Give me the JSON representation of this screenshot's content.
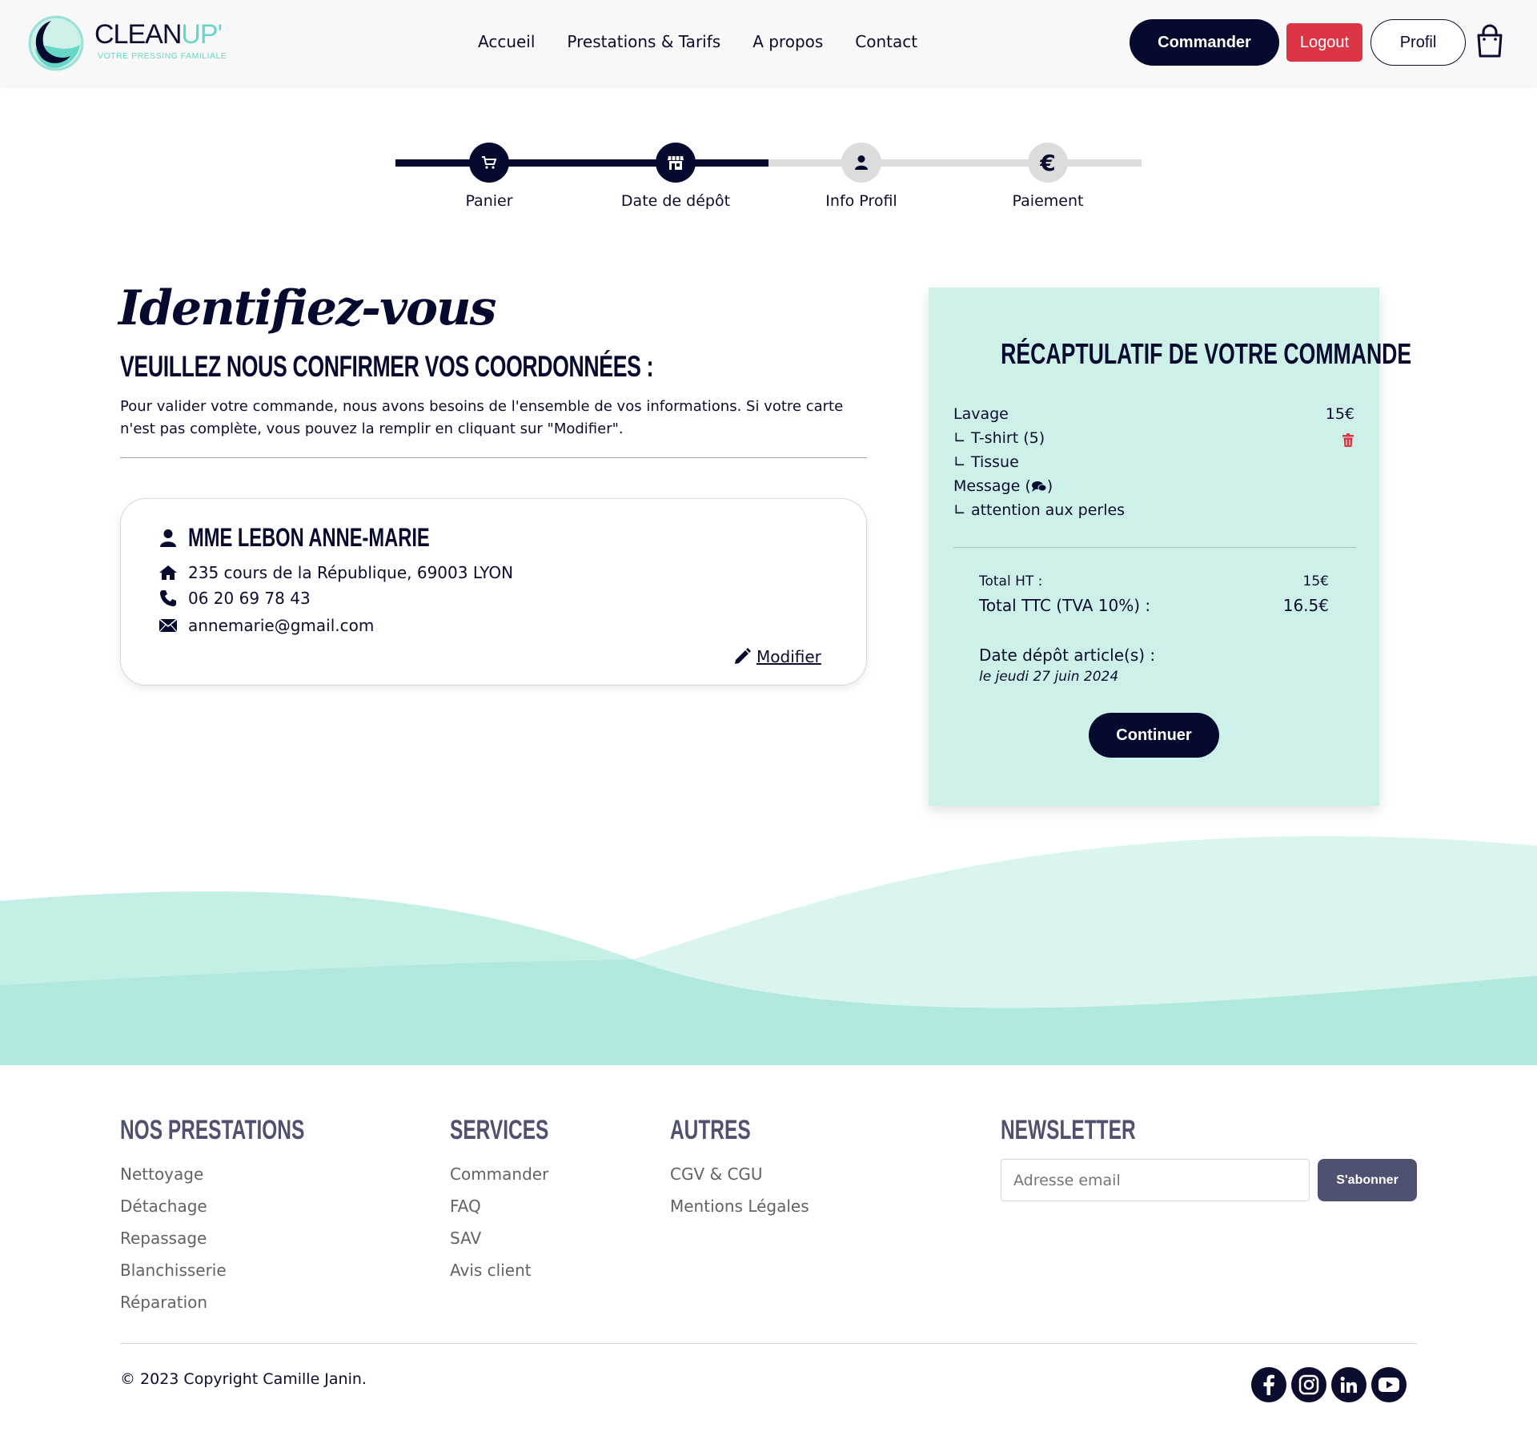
{
  "brand": {
    "name_main": "CLEAN",
    "name_accent": "UP'",
    "tagline": "VOTRE PRESSING FAMILIALE",
    "accent": "#68d6c6",
    "navy": "#050a2e"
  },
  "nav": {
    "items": [
      "Accueil",
      "Prestations & Tarifs",
      "A propos",
      "Contact"
    ]
  },
  "header_actions": {
    "commander": "Commander",
    "logout": "Logout",
    "profil": "Profil",
    "cart_icon": "shopping-bag-icon"
  },
  "stepper": {
    "current_step": 2,
    "steps": [
      {
        "label": "Panier",
        "icon": "cart-icon",
        "done": true
      },
      {
        "label": "Date de dépôt",
        "icon": "store-icon",
        "done": true
      },
      {
        "label": "Info Profil",
        "icon": "user-icon",
        "done": false
      },
      {
        "label": "Paiement",
        "icon": "euro-icon",
        "done": false
      }
    ]
  },
  "main": {
    "script_title": "Identifiez-vous",
    "heading": "VEUILLEZ NOUS CONFIRMER VOS COORDONNÉES :",
    "intro": "Pour valider votre commande, nous avons besoins de l'ensemble de vos informations. Si votre carte n'est pas complète, vous pouvez la remplir en cliquant sur \"Modifier\"."
  },
  "profile_card": {
    "name": "MME LEBON ANNE-MARIE",
    "address": "235 cours de la République, 69003 LYON",
    "phone": "06 20 69 78 43",
    "email": "annemarie@gmail.com",
    "modify": "Modifier"
  },
  "recap": {
    "title": "RÉCAPTULATIF DE VOTRE COMMANDE",
    "service": "Lavage",
    "service_price": "15€",
    "item": "∟ T-shirt (5)",
    "fabric": "∟ Tissue",
    "message_label": "Message (",
    "message_close": ")",
    "message": "∟ attention aux perles",
    "total_ht_label": "Total HT :",
    "total_ht": "15€",
    "total_ttc_label": "Total TTC (TVA 10%) :",
    "total_ttc": "16.5€",
    "date_label": "Date dépôt article(s) :",
    "date_value": "le jeudi 27 juin 2024",
    "continue": "Continuer"
  },
  "footer": {
    "col1": {
      "title": "NOS PRESTATIONS",
      "items": [
        "Nettoyage",
        "Détachage",
        "Repassage",
        "Blanchisserie",
        "Réparation"
      ]
    },
    "col2": {
      "title": "SERVICES",
      "items": [
        "Commander",
        "FAQ",
        "SAV",
        "Avis client"
      ]
    },
    "col3": {
      "title": "AUTRES",
      "items": [
        "CGV & CGU",
        "Mentions Légales"
      ]
    },
    "newsletter": {
      "title": "NEWSLETTER",
      "placeholder": "Adresse email",
      "button": "S'abonner"
    },
    "copyright": "© 2023 Copyright Camille Janin.",
    "socials": [
      "facebook-icon",
      "instagram-icon",
      "linkedin-icon",
      "youtube-icon"
    ]
  }
}
